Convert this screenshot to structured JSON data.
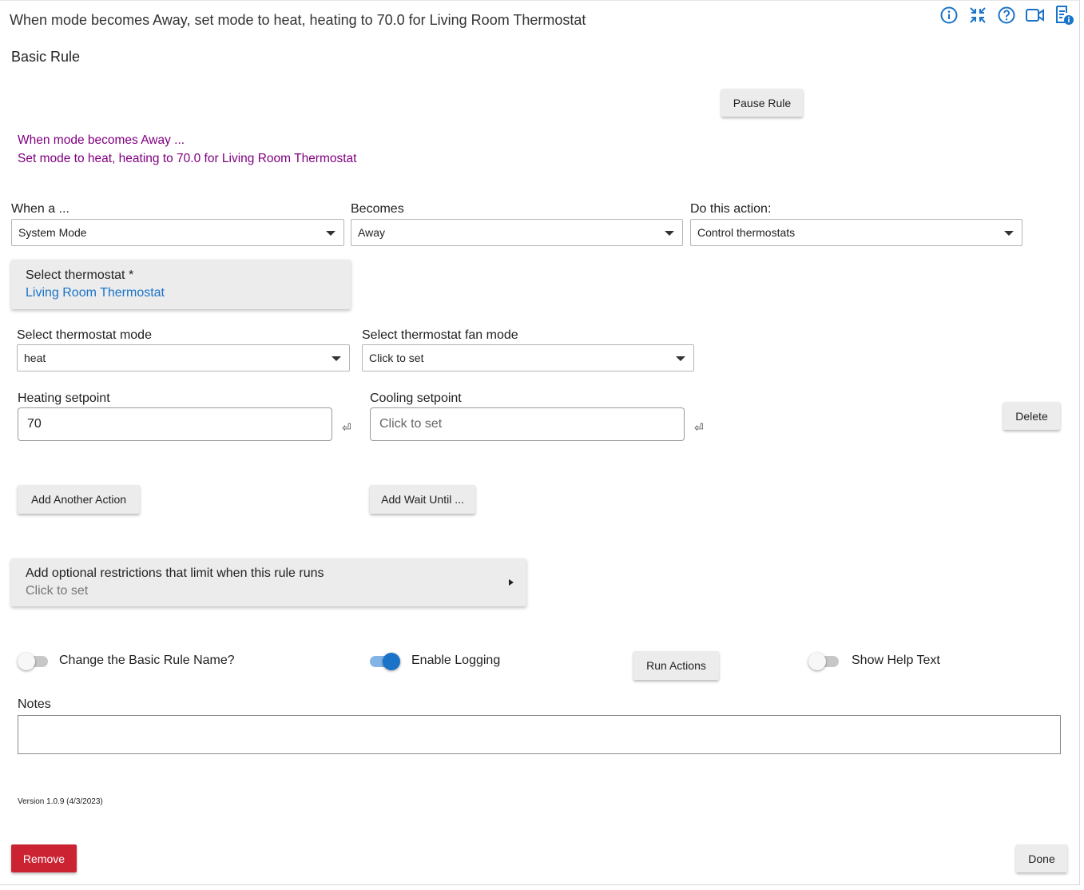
{
  "header": {
    "title": "When mode becomes Away, set mode to heat, heating to 70.0 for Living Room Thermostat",
    "subtitle": "Basic Rule",
    "icons": [
      "info-icon",
      "collapse-icon",
      "help-icon",
      "video-icon",
      "document-info-icon"
    ]
  },
  "pause_button": "Pause Rule",
  "description": {
    "line1": "When mode becomes Away ...",
    "line2": "Set mode to heat, heating to 70.0 for Living Room Thermostat",
    "color": "#800080"
  },
  "trigger": {
    "when_label": "When a ...",
    "when_value": "System Mode",
    "becomes_label": "Becomes",
    "becomes_value": "Away",
    "action_label": "Do this action:",
    "action_value": "Control thermostats"
  },
  "thermostat_card": {
    "label": "Select thermostat *",
    "value": "Living Room Thermostat"
  },
  "thermostat_mode": {
    "label": "Select thermostat mode",
    "value": "heat"
  },
  "fan_mode": {
    "label": "Select thermostat fan mode",
    "value": "Click to set"
  },
  "heating": {
    "label": "Heating setpoint",
    "value": "70"
  },
  "cooling": {
    "label": "Cooling setpoint",
    "placeholder": "Click to set"
  },
  "delete_button": "Delete",
  "add_action_button": "Add Another Action",
  "add_wait_button": "Add Wait Until ...",
  "restrictions": {
    "title": "Add optional restrictions that limit when this rule runs",
    "value": "Click to set"
  },
  "toggles": {
    "rename": {
      "label": "Change the Basic Rule Name?",
      "on": false
    },
    "logging": {
      "label": "Enable Logging",
      "on": true
    },
    "help": {
      "label": "Show Help Text",
      "on": false
    }
  },
  "run_actions_button": "Run Actions",
  "notes": {
    "label": "Notes",
    "value": ""
  },
  "version": "Version 1.0.9 (4/3/2023)",
  "remove_button": "Remove",
  "done_button": "Done",
  "colors": {
    "accent": "#1a73c7",
    "remove": "#cc2333",
    "link": "#1a73c7"
  }
}
